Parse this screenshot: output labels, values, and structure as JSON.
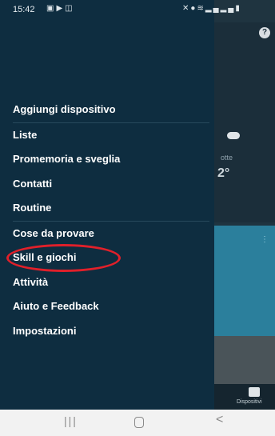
{
  "status_bar": {
    "time": "15:42",
    "left_icons": [
      "gallery-icon",
      "play-icon",
      "cast-icon"
    ],
    "right_icons": [
      "mute-icon",
      "location-icon",
      "wifi-icon",
      "signal-icon",
      "signal-icon",
      "battery-icon"
    ]
  },
  "background_app": {
    "help_label": "?",
    "weather_label": "otte",
    "temperature": "2°",
    "device_label": "Dispositivi"
  },
  "menu": {
    "items": [
      {
        "label": "Aggiungi dispositivo"
      },
      {
        "label": "Liste"
      },
      {
        "label": "Promemoria e sveglia"
      },
      {
        "label": "Contatti"
      },
      {
        "label": "Routine"
      },
      {
        "label": "Cose da provare"
      },
      {
        "label": "Skill e giochi"
      },
      {
        "label": "Attività"
      },
      {
        "label": "Aiuto e Feedback"
      },
      {
        "label": "Impostazioni"
      }
    ],
    "highlighted_item": "Skill e giochi",
    "highlight_color": "#e0202a"
  },
  "android_nav": {
    "recents": "|||",
    "back": "<"
  },
  "colors": {
    "drawer_bg": "#0e2d40",
    "accent_card": "#2b7f9c"
  }
}
